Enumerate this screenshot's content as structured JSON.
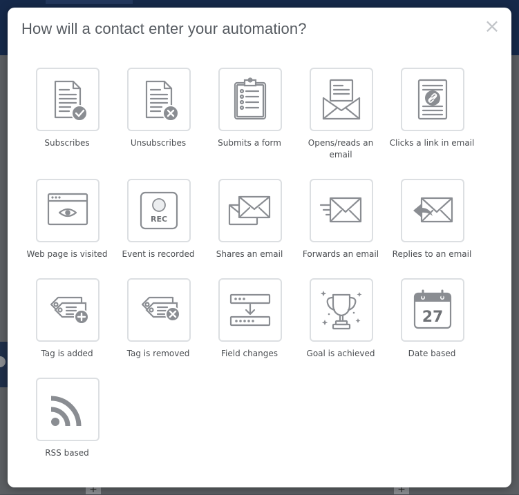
{
  "modal": {
    "title": "How will a contact enter your automation?",
    "close_label": "×"
  },
  "triggers": [
    {
      "label": "Subscribes",
      "icon": "subscribe-icon"
    },
    {
      "label": "Unsubscribes",
      "icon": "unsubscribe-icon"
    },
    {
      "label": "Submits a form",
      "icon": "form-clipboard-icon"
    },
    {
      "label": "Opens/reads an email",
      "icon": "open-envelope-icon"
    },
    {
      "label": "Clicks a link in email",
      "icon": "link-document-icon"
    },
    {
      "label": "Web page is visited",
      "icon": "browser-eye-icon"
    },
    {
      "label": "Event is recorded",
      "icon": "rec-button-icon"
    },
    {
      "label": "Shares an email",
      "icon": "share-envelope-icon"
    },
    {
      "label": "Forwards an email",
      "icon": "forward-envelope-icon"
    },
    {
      "label": "Replies to an email",
      "icon": "reply-envelope-icon"
    },
    {
      "label": "Tag is added",
      "icon": "tag-add-icon"
    },
    {
      "label": "Tag is removed",
      "icon": "tag-remove-icon"
    },
    {
      "label": "Field changes",
      "icon": "field-change-icon"
    },
    {
      "label": "Goal is achieved",
      "icon": "trophy-icon"
    },
    {
      "label": "Date based",
      "icon": "calendar-icon",
      "calendar_day": "27"
    },
    {
      "label": "RSS based",
      "icon": "rss-icon"
    }
  ],
  "rec_text": "REC",
  "colors": {
    "icon_gray": "#8a8d92",
    "tile_border": "#dcdfe2",
    "title_text": "#555a60",
    "overlay_header": "#16294a"
  }
}
